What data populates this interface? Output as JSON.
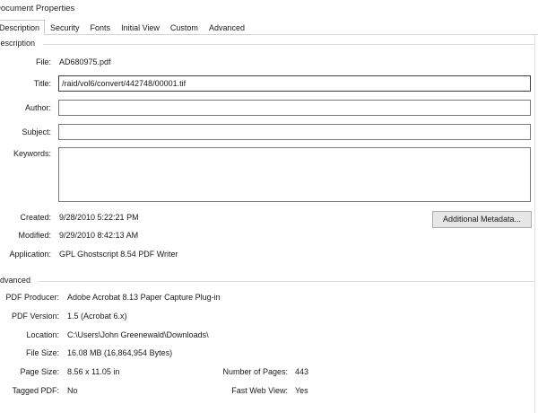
{
  "window": {
    "title": "Document Properties"
  },
  "tabs": [
    {
      "label": "Description"
    },
    {
      "label": "Security"
    },
    {
      "label": "Fonts"
    },
    {
      "label": "Initial View"
    },
    {
      "label": "Custom"
    },
    {
      "label": "Advanced"
    }
  ],
  "description": {
    "group_label": "Description",
    "file_label": "File:",
    "file_value": "AD680975.pdf",
    "title_label": "Title:",
    "title_value": "/raid/vol6/convert/442748/00001.tif",
    "author_label": "Author:",
    "author_value": "",
    "subject_label": "Subject:",
    "subject_value": "",
    "keywords_label": "Keywords:",
    "keywords_value": "",
    "created_label": "Created:",
    "created_value": "9/28/2010 5:22:21 PM",
    "modified_label": "Modified:",
    "modified_value": "9/29/2010 8:42:13 AM",
    "application_label": "Application:",
    "application_value": "GPL Ghostscript 8.54 PDF Writer",
    "metadata_button": "Additional Metadata..."
  },
  "advanced": {
    "group_label": "Advanced",
    "producer_label": "PDF Producer:",
    "producer_value": "Adobe Acrobat 8.13 Paper Capture Plug-in",
    "version_label": "PDF Version:",
    "version_value": "1.5 (Acrobat 6.x)",
    "location_label": "Location:",
    "location_value": "C:\\Users\\John Greenewald\\Downloads\\",
    "filesize_label": "File Size:",
    "filesize_value": "16.08 MB (16,864,954 Bytes)",
    "pagesize_label": "Page Size:",
    "pagesize_value": "8.56 x 11.05 in",
    "numpages_label": "Number of Pages:",
    "numpages_value": "443",
    "tagged_label": "Tagged PDF:",
    "tagged_value": "No",
    "fastweb_label": "Fast Web View:",
    "fastweb_value": "Yes"
  }
}
